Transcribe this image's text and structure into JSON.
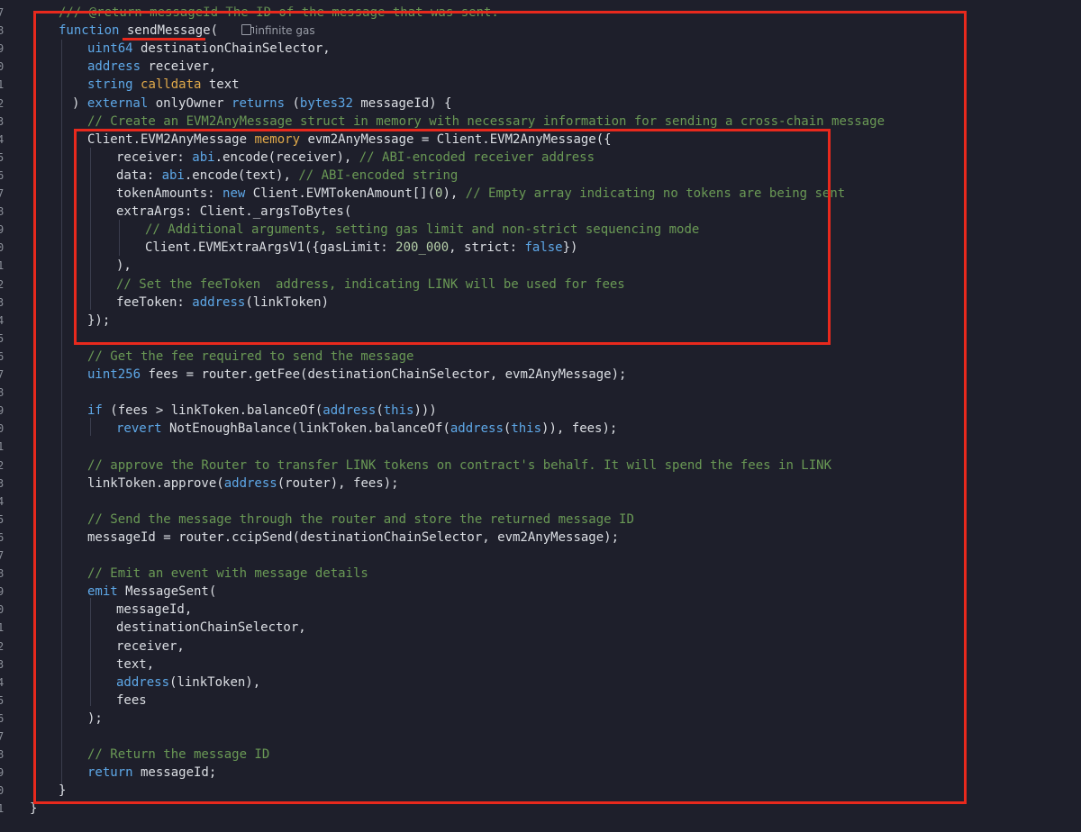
{
  "editor": {
    "codelens": "infinite gas",
    "lines": [
      [
        [
          "cm",
          "/// @return messageId The ID of the message that was sent."
        ]
      ],
      [
        [
          "kw",
          "function"
        ],
        [
          "pl",
          " sendMessage("
        ]
      ],
      [
        [
          "ty",
          "uint64"
        ],
        [
          "pl",
          " destinationChainSelector,"
        ]
      ],
      [
        [
          "ty",
          "address"
        ],
        [
          "pl",
          " receiver,"
        ]
      ],
      [
        [
          "ty",
          "string"
        ],
        [
          "pl",
          " "
        ],
        [
          "or",
          "calldata"
        ],
        [
          "pl",
          " text"
        ]
      ],
      [
        [
          "pl",
          ") "
        ],
        [
          "kw",
          "external"
        ],
        [
          "pl",
          " onlyOwner "
        ],
        [
          "kw",
          "returns"
        ],
        [
          "pl",
          " ("
        ],
        [
          "ty",
          "bytes32"
        ],
        [
          "pl",
          " messageId) {"
        ]
      ],
      [
        [
          "cm",
          "// Create an EVM2AnyMessage struct in memory with necessary information for sending a cross-chain message"
        ]
      ],
      [
        [
          "pl",
          "Client.EVM2AnyMessage "
        ],
        [
          "or",
          "memory"
        ],
        [
          "pl",
          " evm2AnyMessage = Client.EVM2AnyMessage({"
        ]
      ],
      [
        [
          "pl",
          "receiver: "
        ],
        [
          "kw",
          "abi"
        ],
        [
          "pl",
          ".encode(receiver), "
        ],
        [
          "cm",
          "// ABI-encoded receiver address"
        ]
      ],
      [
        [
          "pl",
          "data: "
        ],
        [
          "kw",
          "abi"
        ],
        [
          "pl",
          ".encode(text), "
        ],
        [
          "cm",
          "// ABI-encoded string"
        ]
      ],
      [
        [
          "pl",
          "tokenAmounts: "
        ],
        [
          "kw",
          "new"
        ],
        [
          "pl",
          " Client.EVMTokenAmount[]("
        ],
        [
          "num",
          "0"
        ],
        [
          "pl",
          "), "
        ],
        [
          "cm",
          "// Empty array indicating no tokens are being sent"
        ]
      ],
      [
        [
          "pl",
          "extraArgs: Client._argsToBytes("
        ]
      ],
      [
        [
          "cm",
          "// Additional arguments, setting gas limit and non-strict sequencing mode"
        ]
      ],
      [
        [
          "pl",
          "Client.EVMExtraArgsV1({gasLimit: "
        ],
        [
          "num",
          "200_000"
        ],
        [
          "pl",
          ", strict: "
        ],
        [
          "kw",
          "false"
        ],
        [
          "pl",
          "})"
        ]
      ],
      [
        [
          "pl",
          "),"
        ]
      ],
      [
        [
          "cm",
          "// Set the feeToken  address, indicating LINK will be used for fees"
        ]
      ],
      [
        [
          "pl",
          "feeToken: "
        ],
        [
          "kw",
          "address"
        ],
        [
          "pl",
          "(linkToken)"
        ]
      ],
      [
        [
          "pl",
          "});"
        ]
      ],
      [],
      [
        [
          "cm",
          "// Get the fee required to send the message"
        ]
      ],
      [
        [
          "ty",
          "uint256"
        ],
        [
          "pl",
          " fees = router.getFee(destinationChainSelector, evm2AnyMessage);"
        ]
      ],
      [],
      [
        [
          "kw",
          "if"
        ],
        [
          "pl",
          " (fees > linkToken.balanceOf("
        ],
        [
          "kw",
          "address"
        ],
        [
          "pl",
          "("
        ],
        [
          "kw",
          "this"
        ],
        [
          "pl",
          ")))"
        ]
      ],
      [
        [
          "kw",
          "revert"
        ],
        [
          "pl",
          " NotEnoughBalance(linkToken.balanceOf("
        ],
        [
          "kw",
          "address"
        ],
        [
          "pl",
          "("
        ],
        [
          "kw",
          "this"
        ],
        [
          "pl",
          ")), fees);"
        ]
      ],
      [],
      [
        [
          "cm",
          "// approve the Router to transfer LINK tokens on contract's behalf. It will spend the fees in LINK"
        ]
      ],
      [
        [
          "pl",
          "linkToken.approve("
        ],
        [
          "kw",
          "address"
        ],
        [
          "pl",
          "(router), fees);"
        ]
      ],
      [],
      [
        [
          "cm",
          "// Send the message through the router and store the returned message ID"
        ]
      ],
      [
        [
          "pl",
          "messageId = router.ccipSend(destinationChainSelector, evm2AnyMessage);"
        ]
      ],
      [],
      [
        [
          "cm",
          "// Emit an event with message details"
        ]
      ],
      [
        [
          "kw",
          "emit"
        ],
        [
          "pl",
          " MessageSent("
        ]
      ],
      [
        [
          "pl",
          "messageId,"
        ]
      ],
      [
        [
          "pl",
          "destinationChainSelector,"
        ]
      ],
      [
        [
          "pl",
          "receiver,"
        ]
      ],
      [
        [
          "pl",
          "text,"
        ]
      ],
      [
        [
          "kw",
          "address"
        ],
        [
          "pl",
          "(linkToken),"
        ]
      ],
      [
        [
          "pl",
          "fees"
        ]
      ],
      [
        [
          "pl",
          ");"
        ]
      ],
      [],
      [
        [
          "cm",
          "// Return the message ID"
        ]
      ],
      [
        [
          "kw",
          "return"
        ],
        [
          "pl",
          " messageId;"
        ]
      ],
      [
        [
          "pl",
          "}"
        ]
      ],
      [
        [
          "pl",
          "}"
        ]
      ]
    ],
    "line_numbers": [
      "7",
      "8",
      "9",
      "0",
      "1",
      "2",
      "3",
      "4",
      "5",
      "6",
      "7",
      "8",
      "9",
      "0",
      "1",
      "2",
      "3",
      "4",
      "5",
      "6",
      "7",
      "8",
      "9",
      "0",
      "1",
      "2",
      "3",
      "4",
      "5",
      "6",
      "7",
      "8",
      "9",
      "0",
      "1",
      "2",
      "3",
      "4",
      "5",
      "6",
      "7",
      "8",
      "9",
      "0",
      "1"
    ]
  }
}
